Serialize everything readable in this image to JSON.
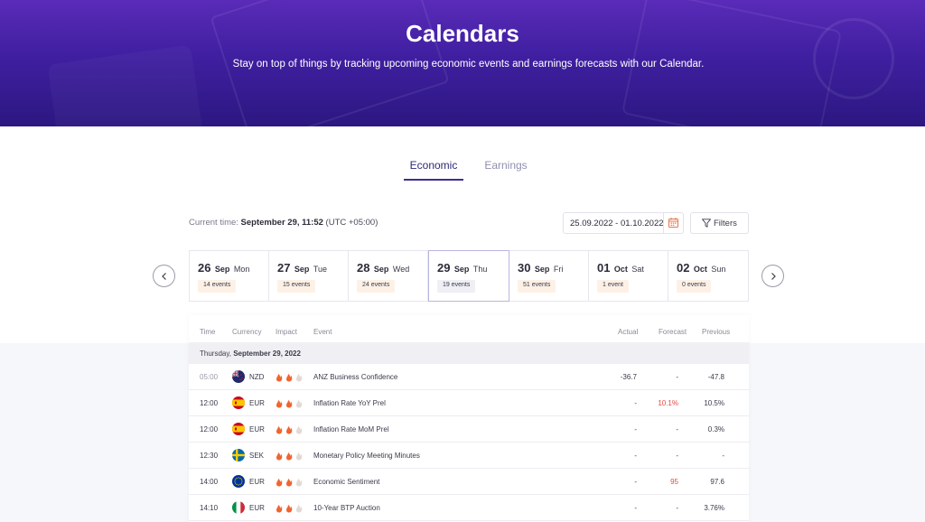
{
  "hero": {
    "title": "Calendars",
    "subtitle": "Stay on top of things by tracking upcoming economic events and earnings forecasts with our Calendar."
  },
  "tabs": [
    {
      "label": "Economic",
      "active": true
    },
    {
      "label": "Earnings",
      "active": false
    }
  ],
  "toolbar": {
    "current_time_label": "Current time:",
    "current_time_value": "September 29, 11:52",
    "timezone": "(UTC +05:00)",
    "date_range": "25.09.2022 - 01.10.2022",
    "filters_label": "Filters"
  },
  "days": [
    {
      "num": "26",
      "month": "Sep",
      "weekday": "Mon",
      "events": "14 events",
      "selected": false
    },
    {
      "num": "27",
      "month": "Sep",
      "weekday": "Tue",
      "events": "15 events",
      "selected": false
    },
    {
      "num": "28",
      "month": "Sep",
      "weekday": "Wed",
      "events": "24 events",
      "selected": false
    },
    {
      "num": "29",
      "month": "Sep",
      "weekday": "Thu",
      "events": "19 events",
      "selected": true
    },
    {
      "num": "30",
      "month": "Sep",
      "weekday": "Fri",
      "events": "51 events",
      "selected": false
    },
    {
      "num": "01",
      "month": "Oct",
      "weekday": "Sat",
      "events": "1 event",
      "selected": false
    },
    {
      "num": "02",
      "month": "Oct",
      "weekday": "Sun",
      "events": "0 events",
      "selected": false
    }
  ],
  "table": {
    "columns": [
      "Time",
      "Currency",
      "Impact",
      "Event",
      "Actual",
      "Forecast",
      "Previous"
    ],
    "group_weekday": "Thursday,",
    "group_date": "September 29, 2022",
    "rows": [
      {
        "time": "05:00",
        "flag": "nz",
        "currency": "NZD",
        "impact": 2,
        "event": "ANZ Business Confidence",
        "actual": "-36.7",
        "forecast": "-",
        "previous": "-47.8",
        "forecast_highlight": false
      },
      {
        "time": "12:00",
        "flag": "es",
        "currency": "EUR",
        "impact": 2,
        "event": "Inflation Rate YoY Prel",
        "actual": "-",
        "forecast": "10.1%",
        "previous": "10.5%",
        "forecast_highlight": true
      },
      {
        "time": "12:00",
        "flag": "es",
        "currency": "EUR",
        "impact": 2,
        "event": "Inflation Rate MoM Prel",
        "actual": "-",
        "forecast": "-",
        "previous": "0.3%",
        "forecast_highlight": false
      },
      {
        "time": "12:30",
        "flag": "se",
        "currency": "SEK",
        "impact": 2,
        "event": "Monetary Policy Meeting Minutes",
        "actual": "-",
        "forecast": "-",
        "previous": "-",
        "forecast_highlight": false
      },
      {
        "time": "14:00",
        "flag": "eu",
        "currency": "EUR",
        "impact": 2,
        "event": "Economic Sentiment",
        "actual": "-",
        "forecast": "95",
        "previous": "97.6",
        "forecast_highlight": true
      },
      {
        "time": "14:10",
        "flag": "it",
        "currency": "EUR",
        "impact": 2,
        "event": "10-Year BTP Auction",
        "actual": "-",
        "forecast": "-",
        "previous": "3.76%",
        "forecast_highlight": false
      }
    ]
  },
  "colors": {
    "hero_top": "#5a2bb8",
    "hero_bottom": "#2c1781",
    "accent": "#3a2f8f",
    "flame_on": "#f0652f",
    "flame_off": "#e3d9d4",
    "forecast_red": "#e5483f"
  }
}
